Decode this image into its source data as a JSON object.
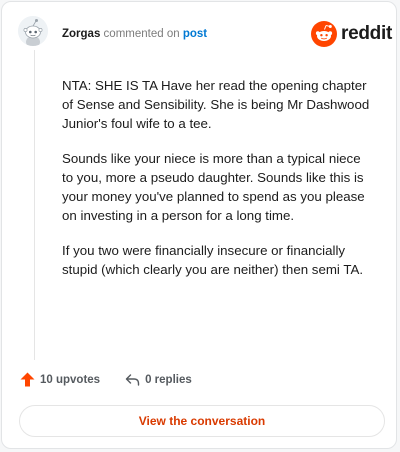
{
  "header": {
    "username": "Zorgas",
    "commented_on": "commented on",
    "post_link": "post",
    "brand": "reddit"
  },
  "comment": {
    "paragraphs": [
      "NTA: SHE IS TA Have her read the opening chapter of Sense and Sensibility. She is being Mr Dashwood Junior's foul wife to a tee.",
      "Sounds like your niece is more than a typical niece to you, more a pseudo daughter. Sounds like this is your money you've planned to spend as you please on investing in a person for a long time.",
      "If you two were financially insecure or financially stupid (which clearly you are neither) then semi TA."
    ]
  },
  "actions": {
    "upvotes": "10 upvotes",
    "replies": "0 replies"
  },
  "cta": {
    "label": "View the conversation"
  },
  "colors": {
    "brand_orange": "#ff4500",
    "link_blue": "#0079d3",
    "cta_text": "#d93a00"
  }
}
